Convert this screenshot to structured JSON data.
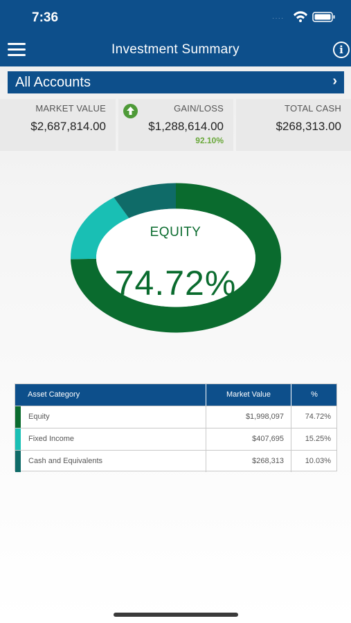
{
  "status": {
    "time": "7:36",
    "signal": "····"
  },
  "nav": {
    "title": "Investment Summary"
  },
  "accounts": {
    "label": "All Accounts",
    "chevron": "›"
  },
  "summary": {
    "market_value": {
      "label": "MARKET VALUE",
      "value": "$2,687,814.00"
    },
    "gain_loss": {
      "label": "GAIN/LOSS",
      "value": "$1,288,614.00",
      "percent": "92.10%",
      "direction": "up"
    },
    "total_cash": {
      "label": "TOTAL CASH",
      "value": "$268,313.00"
    }
  },
  "donut": {
    "label": "EQUITY",
    "value": "74.72%"
  },
  "chart_data": {
    "type": "pie",
    "categories": [
      "Equity",
      "Fixed Income",
      "Cash and Equivalents"
    ],
    "values": [
      74.72,
      15.25,
      10.03
    ],
    "colors": [
      "#0a6b2e",
      "#19bfb4",
      "#0f6b68"
    ]
  },
  "table": {
    "headers": [
      "Asset Category",
      "Market Value",
      "%"
    ],
    "rows": [
      {
        "category": "Equity",
        "market_value": "$1,998,097",
        "percent": "74.72%",
        "color": "#0a6b2e"
      },
      {
        "category": "Fixed Income",
        "market_value": "$407,695",
        "percent": "15.25%",
        "color": "#19bfb4"
      },
      {
        "category": "Cash and Equivalents",
        "market_value": "$268,313",
        "percent": "10.03%",
        "color": "#0f6b68"
      }
    ]
  },
  "icons": {
    "menu": "hamburger-menu-icon",
    "info": "info-icon",
    "gain": "arrow-up-circle-icon",
    "wifi": "wifi-icon",
    "battery": "battery-icon"
  },
  "colors": {
    "brand": "#0d4f8b",
    "equity": "#0a6b2e",
    "positive": "#6aa83b"
  }
}
